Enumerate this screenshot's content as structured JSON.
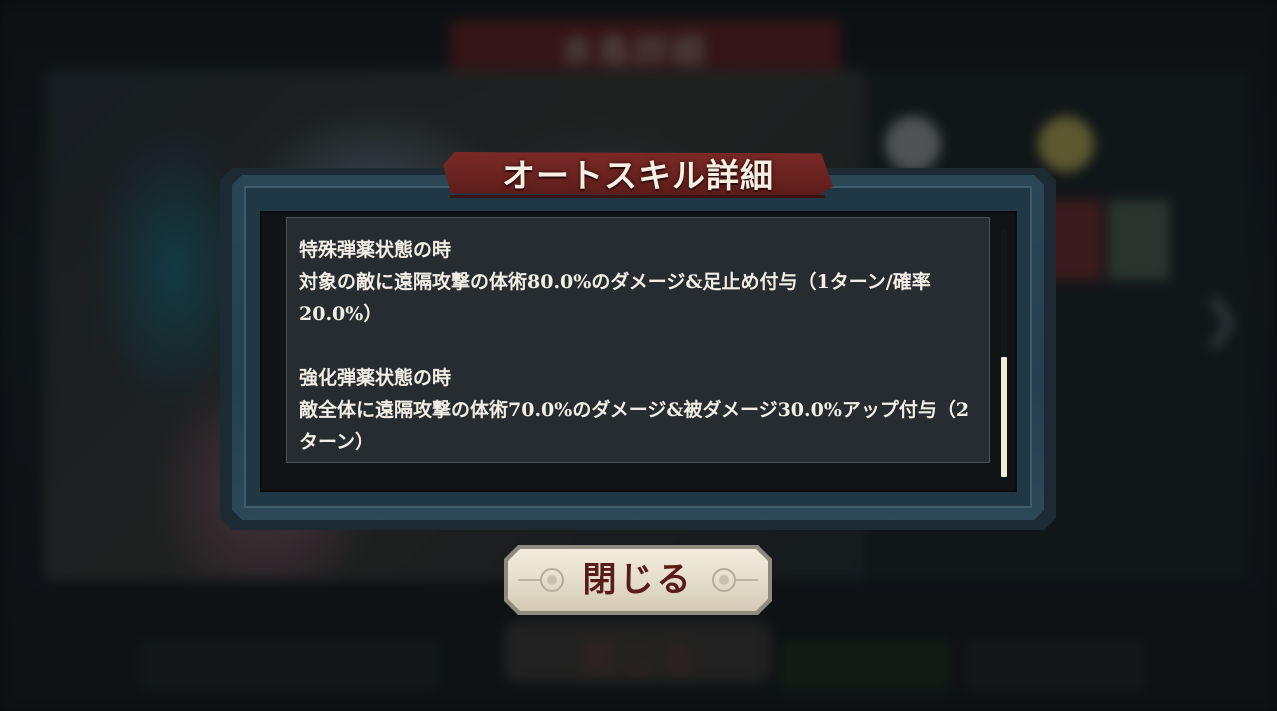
{
  "background": {
    "header_text": "本島詳細",
    "ghost_button_text": "閉じる"
  },
  "dialog": {
    "title": "オートスキル詳細",
    "sections": [
      {
        "title": "特殊弾薬状態の時",
        "body": "対象の敵に遠隔攻撃の体術80.0%のダメージ&足止め付与（1ターン/確率20.0%）"
      },
      {
        "title": "強化弾薬状態の時",
        "body": "敵全体に遠隔攻撃の体術70.0%のダメージ&被ダメージ30.0%アップ付与（2ターン）"
      }
    ],
    "scroll_position": 1.0
  },
  "close_button": {
    "label": "閉じる"
  },
  "colors": {
    "title_banner": "#6b2220",
    "frame": "#274454",
    "panel": "#262c2f",
    "text": "#f2eee6",
    "button_face": "#e8e0cf",
    "button_text": "#5a1c18"
  }
}
